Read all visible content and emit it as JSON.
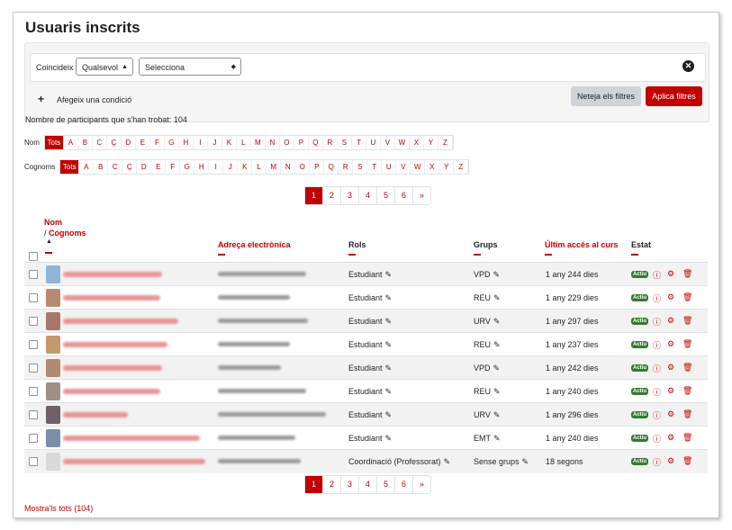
{
  "page": {
    "title": "Usuaris inscrits"
  },
  "filters": {
    "match_label": "Coincideix",
    "match_value": "Qualsevol",
    "select_value": "Selecciona",
    "add_condition": "Afegeix una condició",
    "clear_button": "Neteja els filtres",
    "apply_button": "Aplica filtres"
  },
  "participants_count": "Nombre de participants que s'han trobat: 104",
  "initials": {
    "first_label": "Nom",
    "last_label": "Cognoms",
    "all": "Tots",
    "letters": [
      "A",
      "B",
      "C",
      "Ç",
      "D",
      "E",
      "F",
      "G",
      "H",
      "I",
      "J",
      "K",
      "L",
      "M",
      "N",
      "O",
      "P",
      "Q",
      "R",
      "S",
      "T",
      "U",
      "V",
      "W",
      "X",
      "Y",
      "Z"
    ]
  },
  "pagination": {
    "pages": [
      "1",
      "2",
      "3",
      "4",
      "5",
      "6"
    ],
    "next": "»",
    "current": "1"
  },
  "table": {
    "headers": {
      "name": "Nom",
      "name_sep": " / ",
      "surname": "Cognoms",
      "email": "Adreça electrònica",
      "roles": "Rols",
      "groups": "Grups",
      "last_access": "Últim accés al curs",
      "status": "Estat"
    },
    "rows": [
      {
        "role": "Estudiant",
        "group": "VPD",
        "access": "1 any 244 dies",
        "status": "Actiu"
      },
      {
        "role": "Estudiant",
        "group": "REU",
        "access": "1 any 229 dies",
        "status": "Actiu"
      },
      {
        "role": "Estudiant",
        "group": "URV",
        "access": "1 any 297 dies",
        "status": "Actiu"
      },
      {
        "role": "Estudiant",
        "group": "REU",
        "access": "1 any 237 dies",
        "status": "Actiu"
      },
      {
        "role": "Estudiant",
        "group": "VPD",
        "access": "1 any 242 dies",
        "status": "Actiu"
      },
      {
        "role": "Estudiant",
        "group": "REU",
        "access": "1 any 240 dies",
        "status": "Actiu"
      },
      {
        "role": "Estudiant",
        "group": "URV",
        "access": "1 any 296 dies",
        "status": "Actiu"
      },
      {
        "role": "Estudiant",
        "group": "EMT",
        "access": "1 any 240 dies",
        "status": "Actiu"
      },
      {
        "role": "Coordinació (Professorat)",
        "group": "Sense grups",
        "access": "18 segons",
        "status": "Actiu"
      }
    ]
  },
  "show_all": "Mostra'ls tots (104)",
  "colors": {
    "accent": "#c20000",
    "badge": "#357a32"
  }
}
